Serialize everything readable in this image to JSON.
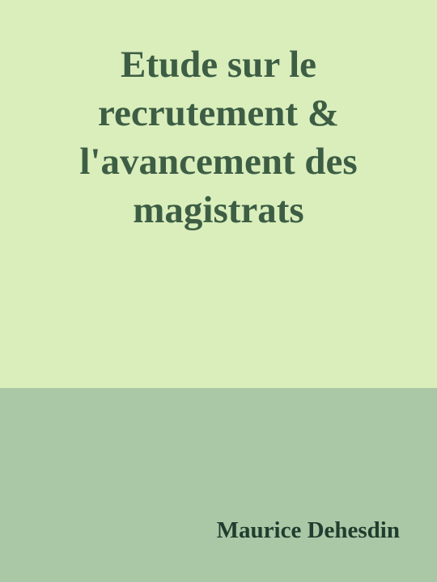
{
  "cover": {
    "title_lines": [
      "Etude sur le",
      "recrutement &",
      "l'avancement des",
      "magistrats"
    ],
    "author": "Maurice Dehesdin"
  },
  "colors": {
    "top_background": "#daeebc",
    "bottom_background": "#aac8a6",
    "title_text": "#3d5e44",
    "author_text": "#213d2f"
  }
}
